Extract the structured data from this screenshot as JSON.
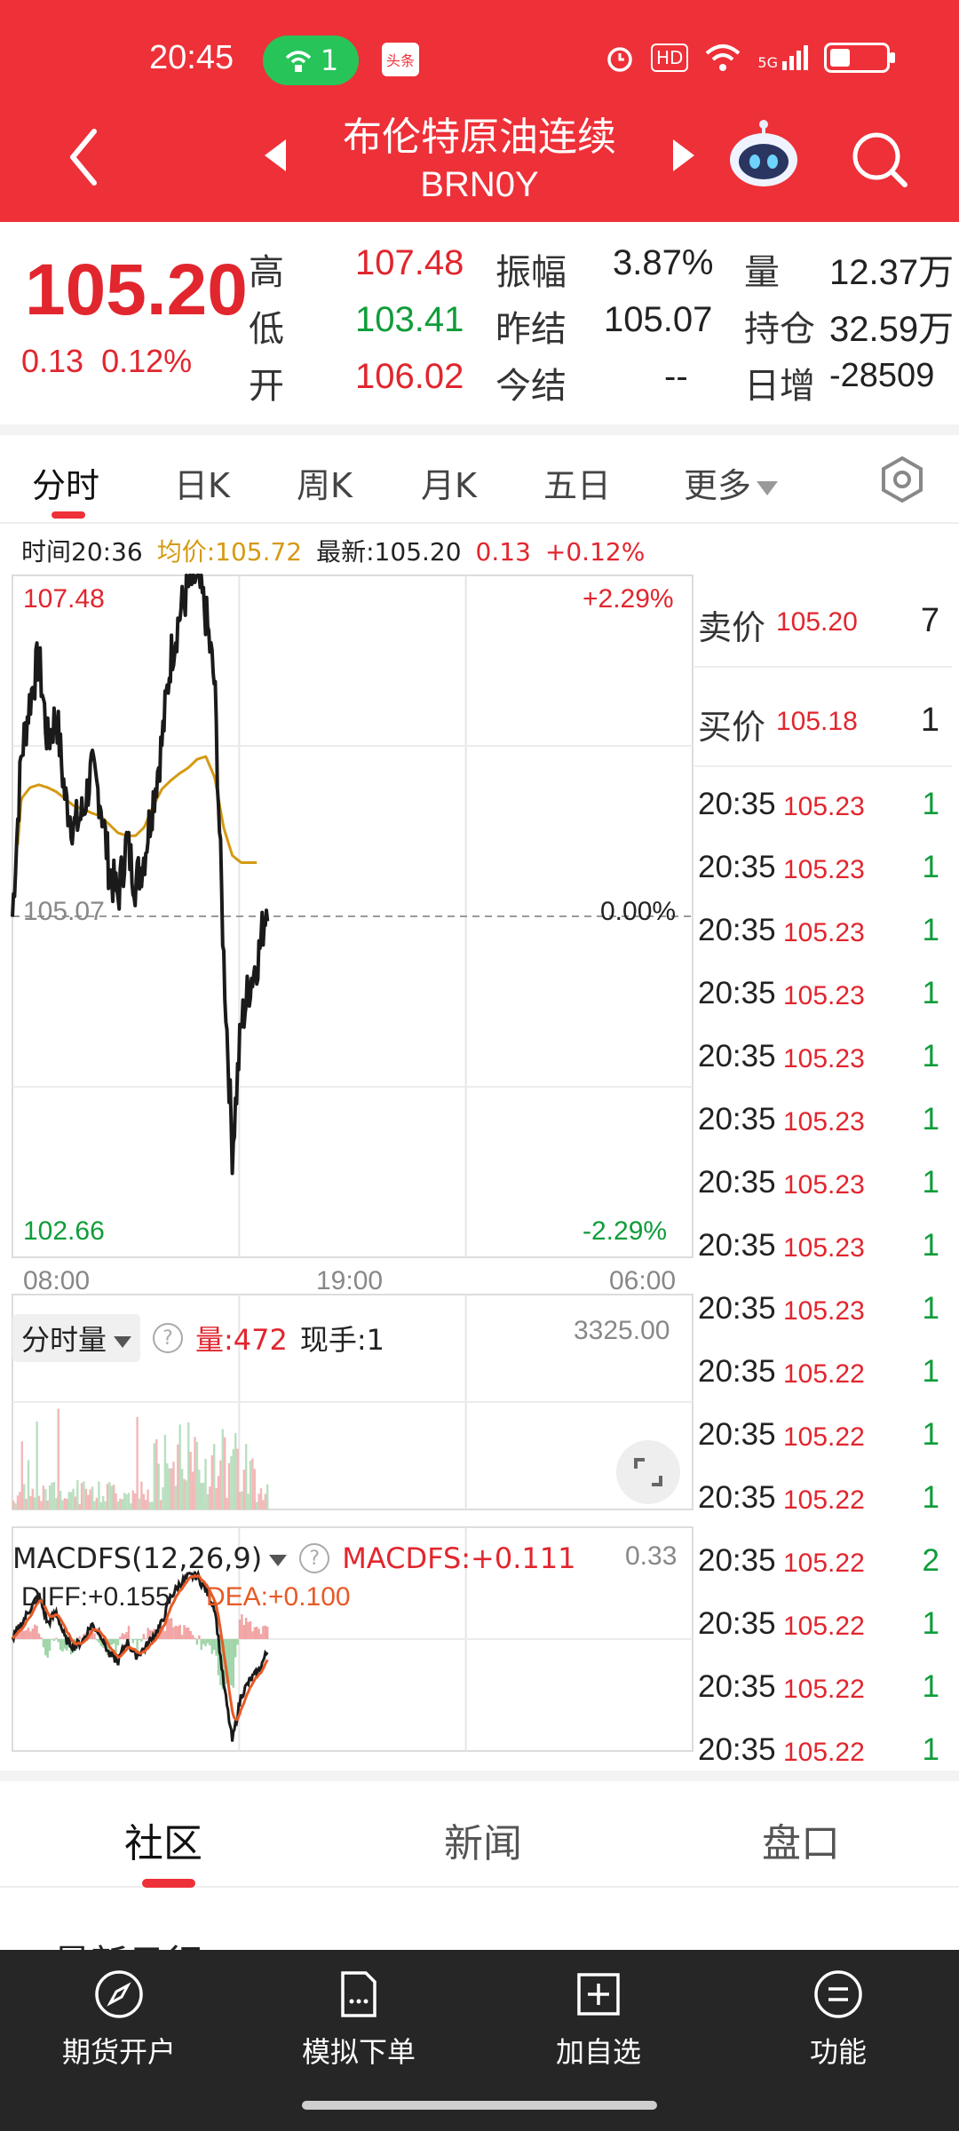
{
  "status_bar": {
    "time": "20:45",
    "hotspot_count": "1",
    "app_badge": "头条",
    "hd": "HD",
    "network": "5G"
  },
  "header": {
    "title": "布伦特原油连续",
    "code": "BRN0Y"
  },
  "quote": {
    "price": "105.20",
    "change": "0.13",
    "change_pct": "0.12%",
    "high_label": "高",
    "high": "107.48",
    "low_label": "低",
    "low": "103.41",
    "open_label": "开",
    "open": "106.02",
    "amplitude_label": "振幅",
    "amplitude": "3.87%",
    "prev_settle_label": "昨结",
    "prev_settle": "105.07",
    "settle_label": "今结",
    "settle": "--",
    "volume_label": "量",
    "volume": "12.37万",
    "oi_label": "持仓",
    "oi": "32.59万",
    "daily_inc_label": "日增",
    "daily_inc": "-28509"
  },
  "tabs": {
    "t1": "分时",
    "t2": "日K",
    "t3": "周K",
    "t4": "月K",
    "t5": "五日",
    "t6": "更多"
  },
  "info": {
    "time": "时间20:36",
    "avg": "均价:105.72",
    "latest": "最新:105.20",
    "change": "0.13",
    "change_pct": "+0.12%"
  },
  "chart": {
    "top_price": "107.48",
    "top_pct": "+2.29%",
    "mid_price": "105.07",
    "mid_pct": "0.00%",
    "bottom_price": "102.66",
    "bottom_pct": "-2.29%",
    "x_labels": [
      "08:00",
      "19:00",
      "06:00"
    ],
    "volume": {
      "selector": "分时量",
      "qmark": "?",
      "amount": "量:472",
      "hand": "现手:1",
      "max": "3325.00"
    },
    "macd": {
      "selector": "MACDFS(12,26,9)",
      "qmark": "?",
      "value": "MACDFS:+0.111",
      "max": "0.33",
      "diff": "DIFF:+0.155",
      "dea": "DEA:+0.100"
    },
    "colors": {
      "price_line": "#1a1a1a",
      "avg_line": "#d49a12",
      "up": "#e1262e",
      "down": "#0f9d3a"
    }
  },
  "chart_data": {
    "type": "line",
    "series": [
      {
        "name": "",
        "values": [
          105.07,
          106.2,
          106.6,
          106.9,
          106.3,
          106.5,
          105.9,
          105.7,
          105.8,
          106.1,
          105.9,
          105.4,
          105.2,
          105.6,
          105.3,
          105.5,
          105.9,
          106.3,
          106.9,
          107.2,
          107.4,
          107.48,
          107.2,
          106.7,
          104.8,
          103.41,
          104.3,
          104.6,
          104.8,
          105.2
        ]
      },
      {
        "name": "",
        "values": [
          105.07,
          105.9,
          105.98,
          106.0,
          105.98,
          105.95,
          105.9,
          105.85,
          105.83,
          105.8,
          105.78,
          105.72,
          105.66,
          105.64,
          105.64,
          105.7,
          105.85,
          105.97,
          106.03,
          106.08,
          106.12,
          106.18,
          106.2,
          106.05,
          105.7,
          105.5,
          105.45,
          105.45,
          105.45,
          105.45
        ]
      }
    ],
    "ylim": [
      102.66,
      107.48
    ]
  },
  "order_book": [
    {
      "label": "卖价",
      "price": "105.20",
      "vol": "7"
    },
    {
      "label": "买价",
      "price": "105.18",
      "vol": "1"
    }
  ],
  "trades": [
    {
      "time": "20:35",
      "price": "105.23",
      "vol": "1"
    },
    {
      "time": "20:35",
      "price": "105.23",
      "vol": "1"
    },
    {
      "time": "20:35",
      "price": "105.23",
      "vol": "1"
    },
    {
      "time": "20:35",
      "price": "105.23",
      "vol": "1"
    },
    {
      "time": "20:35",
      "price": "105.23",
      "vol": "1"
    },
    {
      "time": "20:35",
      "price": "105.23",
      "vol": "1"
    },
    {
      "time": "20:35",
      "price": "105.23",
      "vol": "1"
    },
    {
      "time": "20:35",
      "price": "105.23",
      "vol": "1"
    },
    {
      "time": "20:35",
      "price": "105.23",
      "vol": "1"
    },
    {
      "time": "20:35",
      "price": "105.22",
      "vol": "1"
    },
    {
      "time": "20:35",
      "price": "105.22",
      "vol": "1"
    },
    {
      "time": "20:35",
      "price": "105.22",
      "vol": "1"
    },
    {
      "time": "20:35",
      "price": "105.22",
      "vol": "2"
    },
    {
      "time": "20:35",
      "price": "105.22",
      "vol": "1"
    },
    {
      "time": "20:35",
      "price": "105.22",
      "vol": "1"
    },
    {
      "time": "20:35",
      "price": "105.22",
      "vol": "1"
    }
  ],
  "sections": {
    "s1": "社区",
    "s2": "新闻",
    "s3": "盘口"
  },
  "peek_text": "最新日行",
  "bottom_bar": {
    "b1": "期货开户",
    "b2": "模拟下单",
    "b3": "加自选",
    "b4": "功能"
  }
}
